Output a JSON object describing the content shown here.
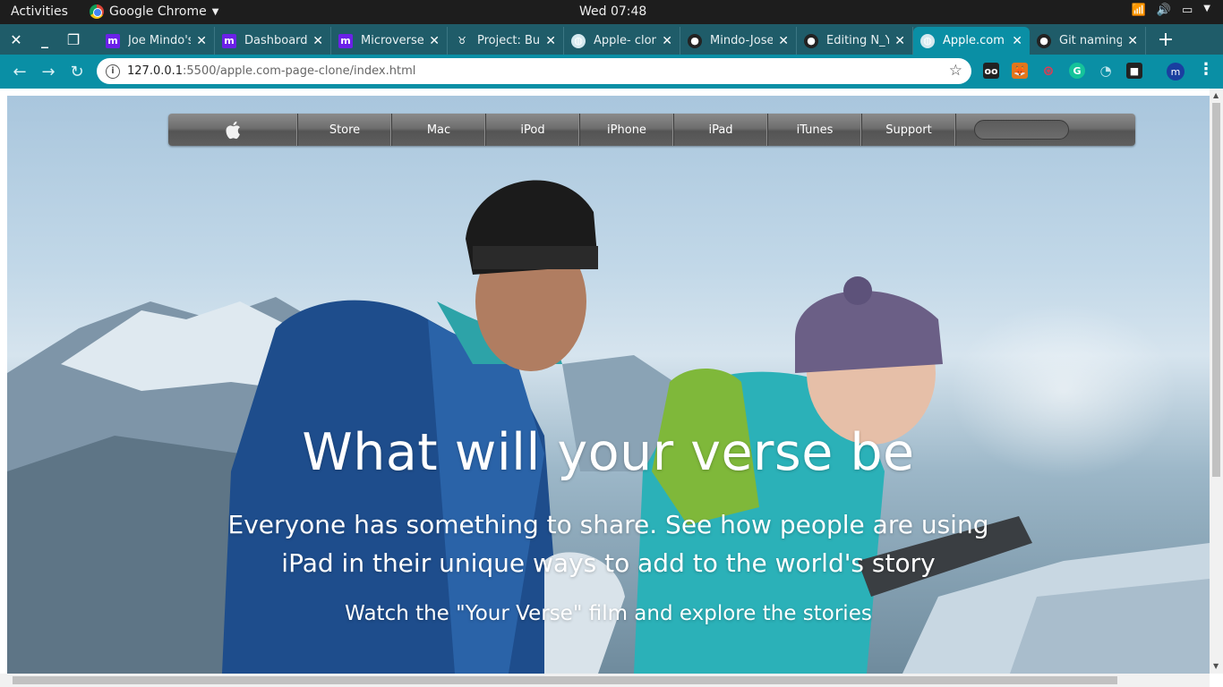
{
  "system": {
    "activities": "Activities",
    "app_name": "Google Chrome",
    "clock": "Wed 07:48"
  },
  "tabs": [
    {
      "title": "Joe Mindo's",
      "favicon": "m"
    },
    {
      "title": "Dashboard",
      "favicon": "m"
    },
    {
      "title": "Microverse",
      "favicon": "m"
    },
    {
      "title": "Project: Buil",
      "favicon": "bot-icon"
    },
    {
      "title": "Apple- clon",
      "favicon": "globe-icon"
    },
    {
      "title": "Mindo-Jose",
      "favicon": "github-icon"
    },
    {
      "title": "Editing N_Y_",
      "favicon": "github-icon"
    },
    {
      "title": "Apple.com",
      "favicon": "globe-icon",
      "active": true
    },
    {
      "title": "Git naming",
      "favicon": "github-icon"
    }
  ],
  "address_bar": {
    "host": "127.0.0.1",
    "path": ":5500/apple.com-page-clone/index.html"
  },
  "profile_initial": "m",
  "apple_nav": {
    "logo": "",
    "items": [
      "Store",
      "Mac",
      "iPod",
      "iPhone",
      "iPad",
      "iTunes",
      "Support"
    ]
  },
  "hero": {
    "headline": "What will your verse be",
    "subhead": "Everyone has something to share. See how people are using iPad in their unique ways to add to the world's story",
    "cta": "Watch the \"Your Verse\" film and explore the stories"
  },
  "colors": {
    "tab_strip": "#1f5c69",
    "toolbar": "#0a8fa5",
    "nav_gradient_top": "#8b8b8b",
    "nav_gradient_bottom": "#545454"
  }
}
